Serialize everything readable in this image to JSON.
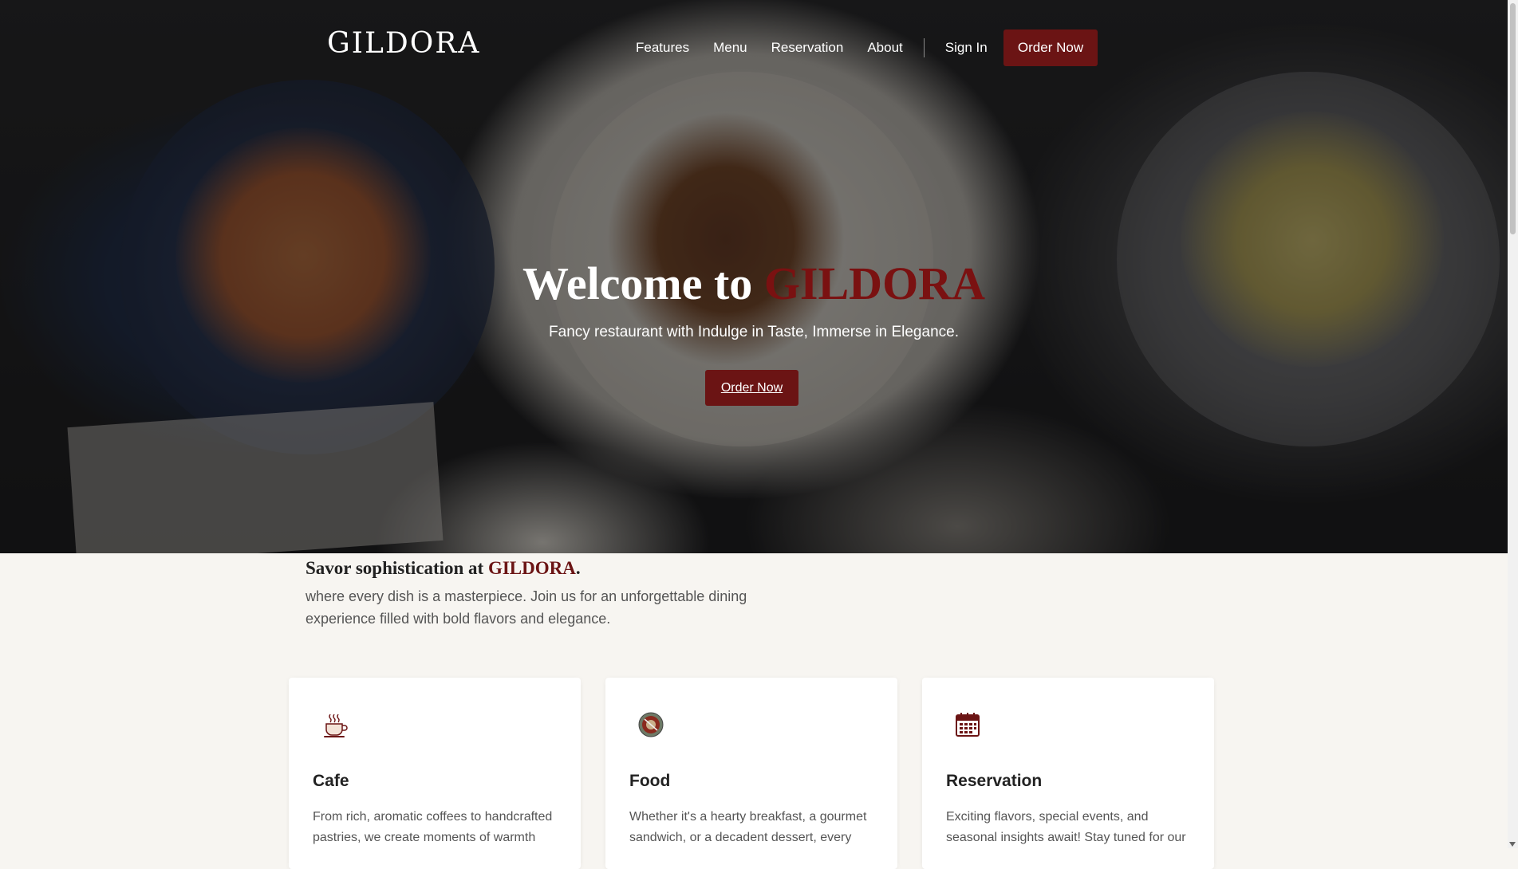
{
  "nav": {
    "logo": "GILDORA",
    "links": [
      "Features",
      "Menu",
      "Reservation",
      "About"
    ],
    "sign_in": "Sign In",
    "order_label": "Order Now"
  },
  "hero": {
    "title_prefix": "Welcome to ",
    "title_brand": "GILDORA",
    "subtitle": "Fancy restaurant with Indulge in Taste, Immerse in Elegance.",
    "button_label": "Order Now"
  },
  "intro": {
    "title_prefix": "Savor sophistication at ",
    "title_brand": "GILDORA",
    "title_suffix": ".",
    "text": "where every dish is a masterpiece. Join us for an unforgettable dining experience filled with bold flavors and elegance."
  },
  "cards": [
    {
      "icon": "coffee-cup-icon",
      "title": "Cafe",
      "text": "From rich, aromatic coffees to handcrafted pastries, we create moments of warmth"
    },
    {
      "icon": "food-plate-icon",
      "title": "Food",
      "text": "Whether it's a hearty breakfast, a gourmet sandwich, or a decadent dessert, every"
    },
    {
      "icon": "calendar-icon",
      "title": "Reservation",
      "text": "Exciting flavors, special events, and seasonal insights await! Stay tuned for our"
    }
  ],
  "colors": {
    "brand": "#6b1414",
    "page_background": "#f7f5f1"
  }
}
